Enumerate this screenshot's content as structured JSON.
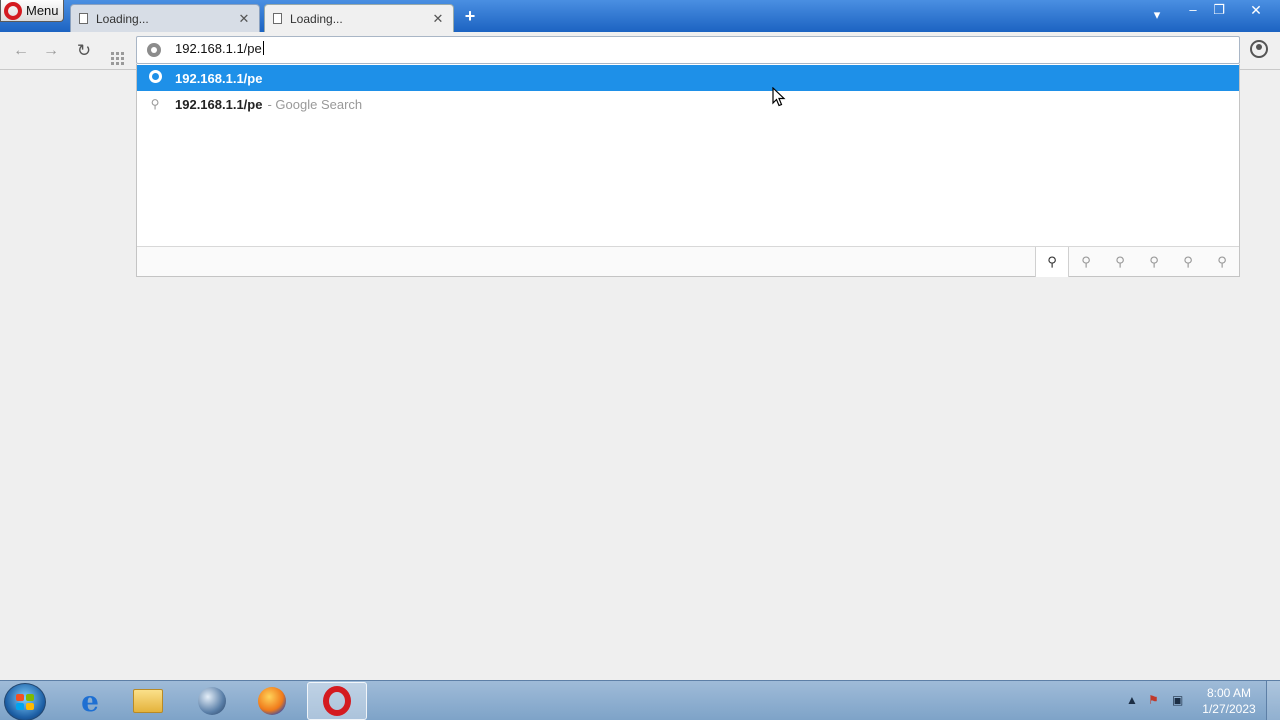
{
  "browser": {
    "menu_label": "Menu",
    "tabs": [
      {
        "title": "Loading...",
        "close": "✕"
      },
      {
        "title": "Loading...",
        "close": "✕"
      }
    ],
    "new_tab_label": "+",
    "window_controls": {
      "tab_list": "▾",
      "minimize": "–",
      "maximize": "❐",
      "close": "✕"
    }
  },
  "toolbar": {
    "back": "←",
    "forward": "→",
    "reload": "↻",
    "address_value": "192.168.1.1/pe"
  },
  "suggestions": {
    "items": [
      {
        "url": "192.168.1.1/pe",
        "extra": "",
        "type": "history"
      },
      {
        "url": "192.168.1.1/pe",
        "extra": "- Google Search",
        "type": "search"
      }
    ],
    "search_engine_glyph": "⚲"
  },
  "taskbar": {
    "apps": [
      "internet-explorer",
      "file-explorer",
      "network-globe",
      "firefox",
      "opera"
    ],
    "active_app": "opera",
    "clock_time": "8:00 AM",
    "clock_date": "1/27/2023",
    "tray_arrow": "▲"
  },
  "colors": {
    "titlebar": "#1c63c2",
    "selection": "#1e90e8",
    "opera_red": "#d41a20"
  }
}
